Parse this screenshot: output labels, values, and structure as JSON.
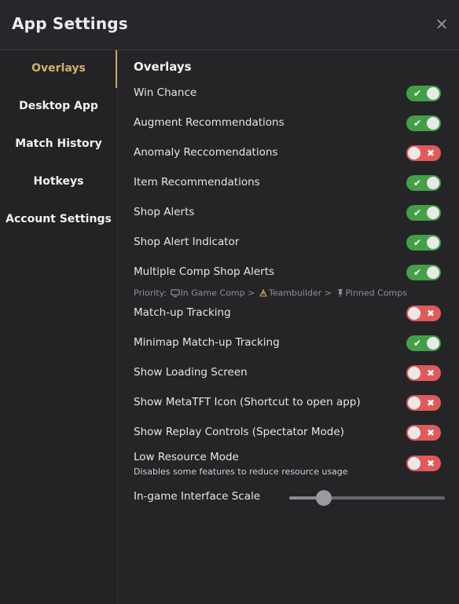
{
  "window": {
    "title": "App Settings",
    "close_glyph": "×"
  },
  "sidebar": {
    "items": [
      {
        "label": "Overlays",
        "active": true
      },
      {
        "label": "Desktop App",
        "active": false
      },
      {
        "label": "Match History",
        "active": false
      },
      {
        "label": "Hotkeys",
        "active": false
      },
      {
        "label": "Account Settings",
        "active": false
      }
    ]
  },
  "overlays": {
    "section_title": "Overlays",
    "settings": [
      {
        "label": "Win Chance",
        "enabled": true
      },
      {
        "label": "Augment Recommendations",
        "enabled": true
      },
      {
        "label": "Anomaly Reccomendations",
        "enabled": false
      },
      {
        "label": "Item Recommendations",
        "enabled": true
      },
      {
        "label": "Shop Alerts",
        "enabled": true
      },
      {
        "label": "Shop Alert Indicator",
        "enabled": true
      },
      {
        "label": "Multiple Comp Shop Alerts",
        "enabled": true
      },
      {
        "label": "Match-up Tracking",
        "enabled": false
      },
      {
        "label": "Minimap Match-up Tracking",
        "enabled": true
      },
      {
        "label": "Show Loading Screen",
        "enabled": false
      },
      {
        "label": "Show MetaTFT Icon (Shortcut to open app)",
        "enabled": false
      },
      {
        "label": "Show Replay Controls (Spectator Mode)",
        "enabled": false
      },
      {
        "label": "Low Resource Mode",
        "enabled": false,
        "description": "Disables some features to reduce resource usage"
      }
    ],
    "priority": {
      "prefix": "Priority:",
      "items": [
        {
          "icon": "monitor-icon",
          "label": "In Game Comp"
        },
        {
          "icon": "teambuilder-icon",
          "label": "Teambuilder"
        },
        {
          "icon": "pin-icon",
          "label": "Pinned Comps"
        }
      ],
      "separator": ">"
    },
    "interface_scale": {
      "label": "In-game Interface Scale",
      "value_fraction": 0.22
    }
  },
  "colors": {
    "accent": "#c9a55c",
    "toggle_on": "#43a047",
    "toggle_off": "#e05a5a"
  }
}
